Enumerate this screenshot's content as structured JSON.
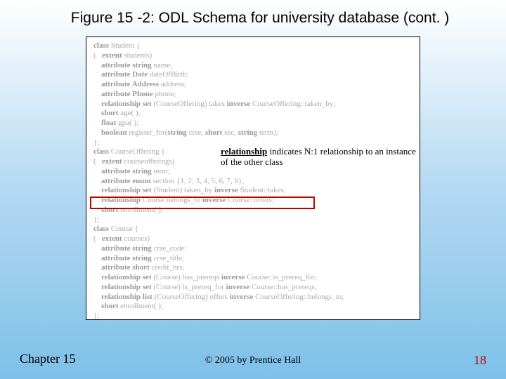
{
  "title": "Figure 15 -2: ODL Schema for university database (cont. )",
  "schema": {
    "student": [
      "class Student {",
      "(   extent students)",
      "    attribute string name;",
      "    attribute Date dateOfBirth;",
      "    attribute Address address;",
      "    attribute Phone phone;",
      "    relationship set (CourseOffering) takes inverse CourseOffering::taken_by;",
      "    short age( );",
      "    float gpa( );",
      "    boolean register_for(string crse, short sec, string term);",
      "};"
    ],
    "offering": [
      "class CourseOffering {",
      "(   extent courseofferings)",
      "    attribute string term;",
      "    attribute enum section {1, 2, 3, 4, 5, 6, 7, 8};",
      "    relationship set (Student) taken_by inverse Student::takes;",
      "    relationship Course belongs_to inverse Course::offers;",
      "    short enrollment( );",
      "};"
    ],
    "course": [
      "class Course {",
      "(   extent courses)",
      "    attribute string crse_code;",
      "    attribute string crse_title;",
      "    attribute short credit_hrs;",
      "    relationship set (Course) has_prereqs inverse Course::is_prereq_for;",
      "    relationship set (Course) is_prereq_for inverse Course::has_prereqs;",
      "    relationship list (CourseOffering) offers inverse CourseOffering::belongs_to;",
      "    short enrollment( );",
      "};"
    ]
  },
  "annotation": {
    "lead": "relationship",
    "rest1": " indicates N:1 relationship to an instance",
    "rest2": "of the other class"
  },
  "footer": {
    "left": "Chapter 15",
    "center": "© 2005 by Prentice Hall",
    "right": "18"
  }
}
